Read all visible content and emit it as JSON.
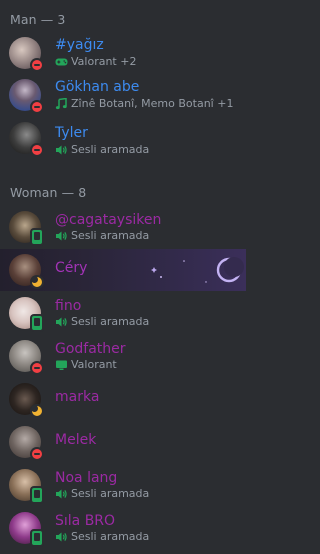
{
  "groups": [
    {
      "header": "Man — 3",
      "members": [
        {
          "name": "#yağız",
          "activity": "Valorant +2",
          "activity_icon": "gamepad-icon",
          "status": "dnd"
        },
        {
          "name": "Gökhan abe",
          "activity": "Zînê Botanî, Memo Botanî +1",
          "activity_icon": "music-note-icon",
          "status": "dnd"
        },
        {
          "name": "Tyler",
          "activity": "Sesli aramada",
          "activity_icon": "speaker-icon",
          "status": "dnd"
        }
      ]
    },
    {
      "header": "Woman — 8",
      "members": [
        {
          "name": "@cagataysiken",
          "activity": "Sesli aramada",
          "activity_icon": "speaker-icon",
          "status": "mobile"
        },
        {
          "name": "Céry",
          "activity": "",
          "status": "idle"
        },
        {
          "name": "fino",
          "activity": "Sesli aramada",
          "activity_icon": "speaker-icon",
          "status": "mobile"
        },
        {
          "name": "Godfather",
          "activity": "Valorant",
          "activity_icon": "screen-icon",
          "status": "dnd"
        },
        {
          "name": "marka",
          "activity": "",
          "status": "idle"
        },
        {
          "name": "Melek",
          "activity": "",
          "status": "dnd"
        },
        {
          "name": "Noa lang",
          "activity": "Sesli aramada",
          "activity_icon": "speaker-icon",
          "status": "mobile"
        },
        {
          "name": "Sıla BRO",
          "activity": "Sesli aramada",
          "activity_icon": "speaker-icon",
          "status": "mobile"
        }
      ]
    }
  ],
  "colors": {
    "background": "#2b2d31",
    "man_role": "#3d8bf0",
    "woman_role": "#9b2aa3",
    "dnd": "#f23f43",
    "online": "#23a55a",
    "idle": "#f0b232",
    "activity_icon": "#23a55a"
  }
}
